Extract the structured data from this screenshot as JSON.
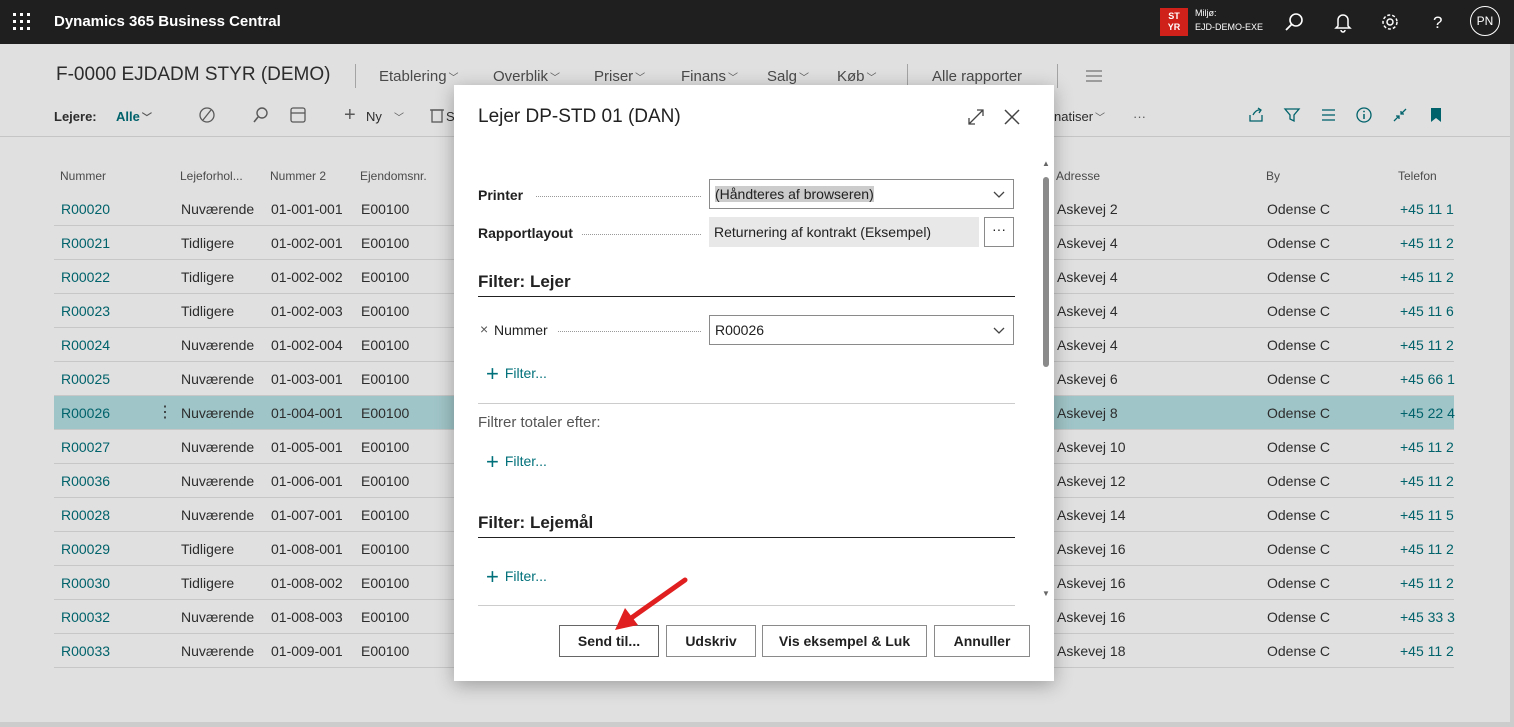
{
  "topbar": {
    "app_title": "Dynamics 365 Business Central",
    "env_badge_line1": "ST",
    "env_badge_line2": "YR",
    "env_label": "Miljø:",
    "env_name": "EJD-DEMO-EXE",
    "avatar_initials": "PN",
    "icons": [
      "waffle-icon",
      "search-icon",
      "bell-icon",
      "gear-icon",
      "help-icon"
    ]
  },
  "nav": {
    "company": "F-0000 EJDADM STYR (DEMO)",
    "items": [
      "Etablering",
      "Overblik",
      "Priser",
      "Finans",
      "Salg",
      "Køb"
    ],
    "all_reports": "Alle rapporter"
  },
  "actionbar": {
    "filter_label": "Lejere:",
    "filter_value": "Alle",
    "new_label": "Ny",
    "partial_left": "S",
    "partial_right": "natiser",
    "more": "···"
  },
  "table": {
    "headers": {
      "nummer": "Nummer",
      "lejeforhold": "Lejeforhol...",
      "nummer2": "Nummer 2",
      "ejendomsnr": "Ejendomsnr.",
      "adresse": "Adresse",
      "by": "By",
      "telefon": "Telefon"
    },
    "rows": [
      {
        "nr": "R00020",
        "status": "Nuværende",
        "nr2": "01-001-001",
        "ejd": "E00100",
        "adr": "Askevej 2",
        "by": "Odense C",
        "tel": "+45 11 1"
      },
      {
        "nr": "R00021",
        "status": "Tidligere",
        "nr2": "01-002-001",
        "ejd": "E00100",
        "adr": "Askevej 4",
        "by": "Odense C",
        "tel": "+45 11 2"
      },
      {
        "nr": "R00022",
        "status": "Tidligere",
        "nr2": "01-002-002",
        "ejd": "E00100",
        "adr": "Askevej 4",
        "by": "Odense C",
        "tel": "+45 11 2"
      },
      {
        "nr": "R00023",
        "status": "Tidligere",
        "nr2": "01-002-003",
        "ejd": "E00100",
        "adr": "Askevej 4",
        "by": "Odense C",
        "tel": "+45 11 6"
      },
      {
        "nr": "R00024",
        "status": "Nuværende",
        "nr2": "01-002-004",
        "ejd": "E00100",
        "adr": "Askevej 4",
        "by": "Odense C",
        "tel": "+45 11 2"
      },
      {
        "nr": "R00025",
        "status": "Nuværende",
        "nr2": "01-003-001",
        "ejd": "E00100",
        "adr": "Askevej 6",
        "by": "Odense C",
        "tel": "+45 66 1"
      },
      {
        "nr": "R00026",
        "status": "Nuværende",
        "nr2": "01-004-001",
        "ejd": "E00100",
        "adr": "Askevej 8",
        "by": "Odense C",
        "tel": "+45 22 4"
      },
      {
        "nr": "R00027",
        "status": "Nuværende",
        "nr2": "01-005-001",
        "ejd": "E00100",
        "adr": "Askevej 10",
        "by": "Odense C",
        "tel": "+45 11 2"
      },
      {
        "nr": "R00036",
        "status": "Nuværende",
        "nr2": "01-006-001",
        "ejd": "E00100",
        "adr": "Askevej 12",
        "by": "Odense C",
        "tel": "+45 11 2"
      },
      {
        "nr": "R00028",
        "status": "Nuværende",
        "nr2": "01-007-001",
        "ejd": "E00100",
        "adr": "Askevej 14",
        "by": "Odense C",
        "tel": "+45 11 5"
      },
      {
        "nr": "R00029",
        "status": "Tidligere",
        "nr2": "01-008-001",
        "ejd": "E00100",
        "adr": "Askevej 16",
        "by": "Odense C",
        "tel": "+45 11 2"
      },
      {
        "nr": "R00030",
        "status": "Tidligere",
        "nr2": "01-008-002",
        "ejd": "E00100",
        "adr": "Askevej 16",
        "by": "Odense C",
        "tel": "+45 11 2"
      },
      {
        "nr": "R00032",
        "status": "Nuværende",
        "nr2": "01-008-003",
        "ejd": "E00100",
        "adr": "Askevej 16",
        "by": "Odense C",
        "tel": "+45 33 3"
      },
      {
        "nr": "R00033",
        "status": "Nuværende",
        "nr2": "01-009-001",
        "ejd": "E00100",
        "adr": "Askevej 18",
        "by": "Odense C",
        "tel": "+45 11 2"
      }
    ],
    "selected_row": 6
  },
  "dialog": {
    "title": "Lejer DP-STD 01 (DAN)",
    "printer_label": "Printer",
    "printer_value": "(Håndteres af browseren)",
    "layout_label": "Rapportlayout",
    "layout_value": "Returnering af kontrakt (Eksempel)",
    "more_button": "···",
    "section1": "Filter: Lejer",
    "filter_field_remove": "×",
    "filter_field_label": "Nummer",
    "filter_field_value": "R00026",
    "add_filter": "Filter...",
    "totals_label": "Filtrer totaler efter:",
    "section2": "Filter: Lejemål",
    "buttons": {
      "send": "Send til...",
      "print": "Udskriv",
      "preview": "Vis eksempel & Luk",
      "cancel": "Annuller"
    },
    "annotation_color": "#e02020"
  }
}
